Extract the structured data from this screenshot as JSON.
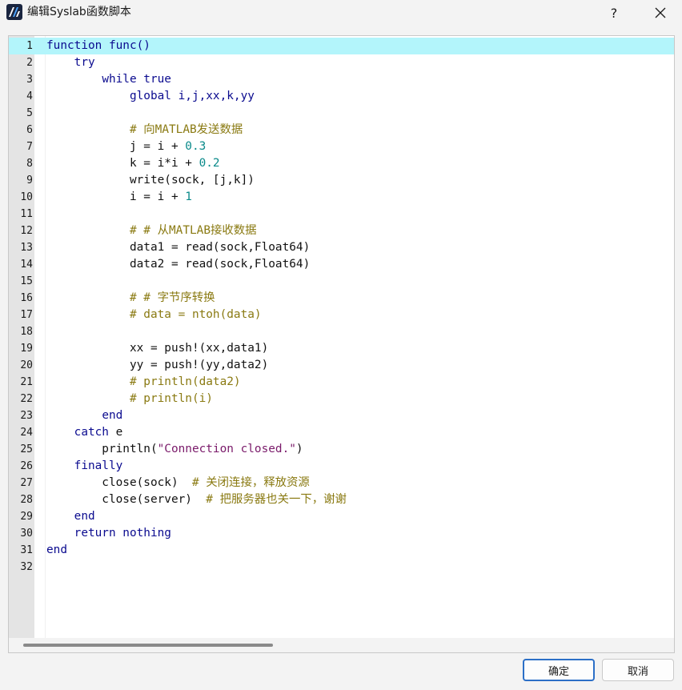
{
  "window": {
    "title": "编辑Syslab函数脚本",
    "help_label": "?",
    "icon": "syslab-logo-icon",
    "close_icon": "close-icon"
  },
  "editor": {
    "current_line": 1,
    "lines": [
      [
        [
          "kw",
          "function func()"
        ]
      ],
      [
        [
          "",
          "    "
        ],
        [
          "kw",
          "try"
        ]
      ],
      [
        [
          "",
          "        "
        ],
        [
          "kw",
          "while true"
        ]
      ],
      [
        [
          "",
          "            "
        ],
        [
          "kw",
          "global i,j,xx,k,yy"
        ]
      ],
      [],
      [
        [
          "",
          "            "
        ],
        [
          "cm",
          "# 向MATLAB发送数据"
        ]
      ],
      [
        [
          "",
          "            j = i + "
        ],
        [
          "num",
          "0.3"
        ]
      ],
      [
        [
          "",
          "            k = i*i + "
        ],
        [
          "num",
          "0.2"
        ]
      ],
      [
        [
          "",
          "            write(sock, [j,k])"
        ]
      ],
      [
        [
          "",
          "            i = i + "
        ],
        [
          "num",
          "1"
        ]
      ],
      [],
      [
        [
          "",
          "            "
        ],
        [
          "cm",
          "# # 从MATLAB接收数据"
        ]
      ],
      [
        [
          "",
          "            data1 = read(sock,Float64)"
        ]
      ],
      [
        [
          "",
          "            data2 = read(sock,Float64)"
        ]
      ],
      [],
      [
        [
          "",
          "            "
        ],
        [
          "cm",
          "# # 字节序转换"
        ]
      ],
      [
        [
          "",
          "            "
        ],
        [
          "cm",
          "# data = ntoh(data)"
        ]
      ],
      [],
      [
        [
          "",
          "            xx = push!(xx,data1)"
        ]
      ],
      [
        [
          "",
          "            yy = push!(yy,data2)"
        ]
      ],
      [
        [
          "",
          "            "
        ],
        [
          "cm",
          "# println(data2)"
        ]
      ],
      [
        [
          "",
          "            "
        ],
        [
          "cm",
          "# println(i)"
        ]
      ],
      [
        [
          "",
          "        "
        ],
        [
          "kw",
          "end"
        ]
      ],
      [
        [
          "",
          "    "
        ],
        [
          "kw",
          "catch"
        ],
        [
          "",
          " e"
        ]
      ],
      [
        [
          "",
          "        println("
        ],
        [
          "str",
          "\"Connection closed.\""
        ],
        [
          "",
          ")"
        ]
      ],
      [
        [
          "",
          "    "
        ],
        [
          "kw",
          "finally"
        ]
      ],
      [
        [
          "",
          "        close(sock)  "
        ],
        [
          "cm",
          "# 关闭连接，释放资源"
        ]
      ],
      [
        [
          "",
          "        close(server)  "
        ],
        [
          "cm",
          "# 把服务器也关一下，谢谢"
        ]
      ],
      [
        [
          "",
          "    "
        ],
        [
          "kw",
          "end"
        ]
      ],
      [
        [
          "",
          "    "
        ],
        [
          "kw",
          "return nothing"
        ]
      ],
      [
        [
          "kw",
          "end"
        ]
      ],
      []
    ]
  },
  "buttons": {
    "ok_label": "确定",
    "cancel_label": "取消"
  },
  "colors": {
    "keyword": "#0b0b8f",
    "number": "#0a8a8a",
    "comment": "#8a7a12",
    "string": "#7a1a6a",
    "current_line": "#b3f5fb",
    "primary_border": "#2c6fc7"
  }
}
